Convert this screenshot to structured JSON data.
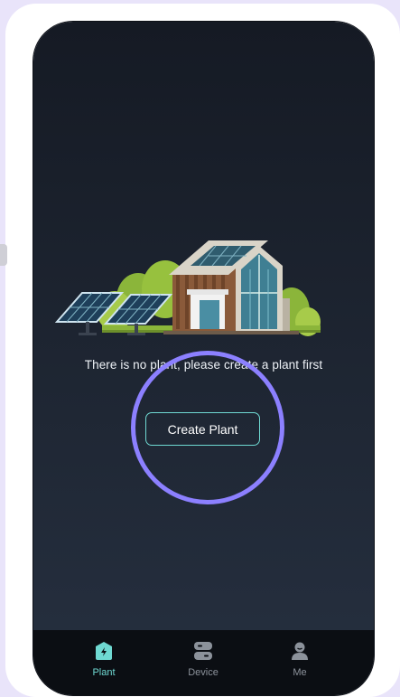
{
  "empty_state": {
    "message": "There is no plant, please create a plant first",
    "illustration_icon": "house-with-solar-panels-illustration"
  },
  "actions": {
    "create_plant_label": "Create Plant"
  },
  "tabbar": {
    "tabs": [
      {
        "label": "Plant",
        "icon": "plant-bolt-icon",
        "active": true
      },
      {
        "label": "Device",
        "icon": "device-icon",
        "active": false
      },
      {
        "label": "Me",
        "icon": "user-icon",
        "active": false
      }
    ]
  },
  "colors": {
    "accent": "#6fd9d2",
    "highlight_ring": "#8c80ff",
    "background_top": "#151a24",
    "background_bottom": "#263040",
    "tabbar": "#0b0e13",
    "inactive_tab": "#8c929b"
  }
}
